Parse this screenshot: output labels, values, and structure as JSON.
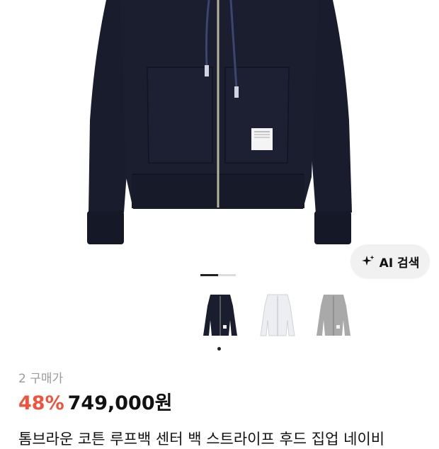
{
  "product": {
    "image_alt": "navy zip-up hoodie",
    "purchase_count": "2 구매가",
    "discount": "48%",
    "price": "749,000원",
    "title": "톰브라운 코튼 루프백 센터 백 스트라이프 후드 집업 네이비"
  },
  "ai_search": {
    "label": "AI 검색",
    "icon": "sparkle-icon"
  },
  "pager": {
    "count": 2,
    "active": 0
  },
  "thumbnails": [
    {
      "name": "navy",
      "color": "#191d2e",
      "selected": true
    },
    {
      "name": "white",
      "color": "#eceef2",
      "selected": false
    },
    {
      "name": "gray",
      "color": "#a9a9aa",
      "selected": false
    }
  ],
  "colors": {
    "accent": "#f0533d",
    "text": "#111111",
    "muted": "#9a9a9a"
  }
}
